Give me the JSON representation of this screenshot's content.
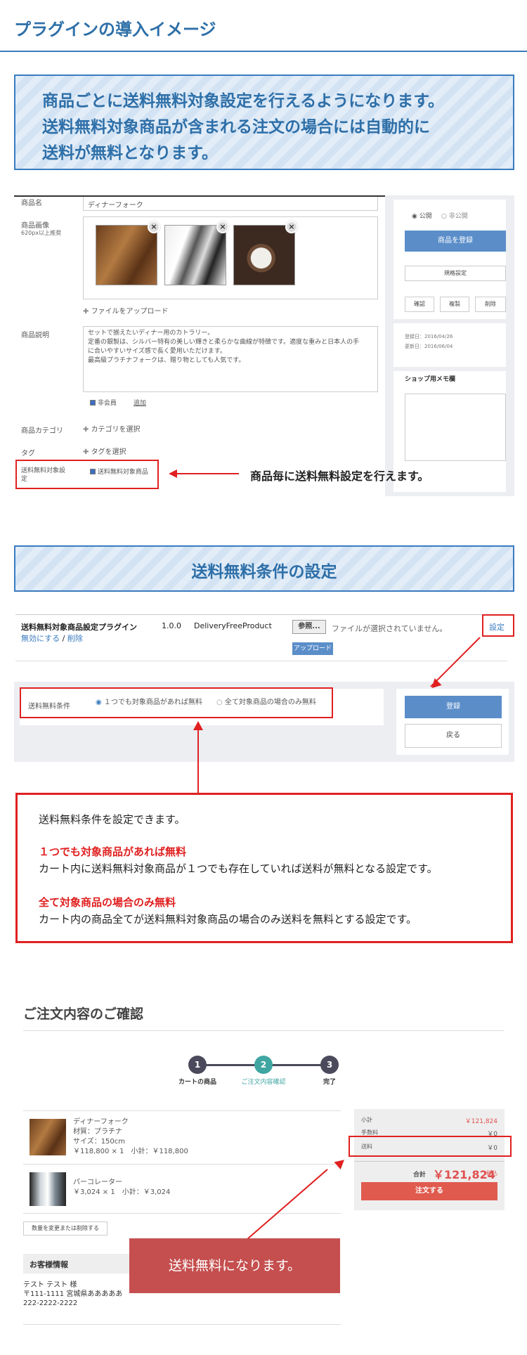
{
  "page_title": "プラグインの導入イメージ",
  "banner1": {
    "line1": "商品ごとに送料無料対象設定を行えるようになります。",
    "line2": "送料無料対象商品が含まれる注文の場合には自動的に",
    "line3": "送料が無料となります。"
  },
  "product_form": {
    "name_label": "商品名",
    "name_value": "ディナーフォーク",
    "image_label": "商品画像",
    "image_hint": "620px以上推奨",
    "upload_link": "ファイルをアップロード",
    "desc_label": "商品説明",
    "desc_lines": [
      "セットで揃えたいディナー用のカトラリー。",
      "定番の銀製は、シルバー特有の美しい輝きと柔らかな曲線が特徴です。適度な重みと日本人の手",
      "に合いやすいサイズ感で長く愛用いただけます。",
      "最高級プラチナフォークは、贈り物としても人気です。"
    ],
    "hidden_member_label": "非会員",
    "add_link": "追加",
    "category_label": "商品カテゴリ",
    "category_link": "カテゴリを選択",
    "tag_label": "タグ",
    "tag_link": "タグを選択",
    "free_ship_label": "送料無料対象設定",
    "free_ship_checkbox": "送料無料対象商品"
  },
  "side_panel": {
    "public": "公開",
    "private": "非公開",
    "register_button": "商品を登録",
    "spec_button": "規格設定",
    "confirm_button": "確認",
    "copy_button": "複製",
    "delete_button": "削除",
    "registered": "登録日：2016/04/26",
    "updated": "更新日：2016/06/04",
    "memo_title": "ショップ用メモ欄"
  },
  "callout1": "商品毎に送料無料設定を行えます。",
  "banner2": "送料無料条件の設定",
  "plugin": {
    "name": "送料無料対象商品設定プラグイン",
    "disable_link": "無効にする",
    "slash": "/",
    "delete_link": "削除",
    "version": "1.0.0",
    "code": "DeliveryFreeProduct",
    "browse_button": "参照...",
    "no_file": "ファイルが選択されていません。",
    "upload_button": "アップロード",
    "settings_link": "設定"
  },
  "condition": {
    "label": "送料無料条件",
    "option1": "１つでも対象商品があれば無料",
    "option2": "全て対象商品の場合のみ無料",
    "register_button": "登録",
    "back_button": "戻る"
  },
  "info_box": {
    "heading": "送料無料条件を設定できます。",
    "opt1_title": "１つでも対象商品があれば無料",
    "opt1_desc": "カート内に送料無料対象商品が１つでも存在していれば送料が無料となる設定です。",
    "opt2_title": "全て対象商品の場合のみ無料",
    "opt2_desc": "カート内の商品全てが送料無料対象商品の場合のみ送料を無料とする設定です。"
  },
  "confirm": {
    "title": "ご注文内容のご確認",
    "steps": [
      {
        "num": "1",
        "label": "カートの商品"
      },
      {
        "num": "2",
        "label": "ご注文内容確認"
      },
      {
        "num": "3",
        "label": "完了"
      }
    ],
    "items": [
      {
        "name": "ディナーフォーク",
        "material": "材質：プラチナ",
        "size": "サイズ：150cm",
        "price": "￥118,800 × 1　小計：￥118,800"
      },
      {
        "name": "パーコレーター",
        "price": "￥3,024 × 1　小計：￥3,024"
      }
    ],
    "change_button": "数量を変更または削除する",
    "customer_title": "お客様情報",
    "customer_name": "テスト テスト 様",
    "customer_address": "〒111-1111 宮城県あああああ",
    "customer_phone": "222-2222-2222",
    "summary": {
      "subtotal_label": "小計",
      "subtotal_value": "￥121,824",
      "fee_label": "手数料",
      "fee_value": "￥0",
      "shipping_label": "送料",
      "shipping_value": "￥0",
      "total_label": "合計",
      "total_value": "￥121,824",
      "tax_label": "税込",
      "order_button": "注文する"
    }
  },
  "callout2": "送料無料になります。",
  "colors": {
    "accent": "#2e6fa8",
    "red": "#e02020",
    "button_blue": "#5b8ec9",
    "callout_bg": "#c54f4f",
    "step_teal": "#3fa6a2",
    "step_dark": "#4a4a5c"
  }
}
